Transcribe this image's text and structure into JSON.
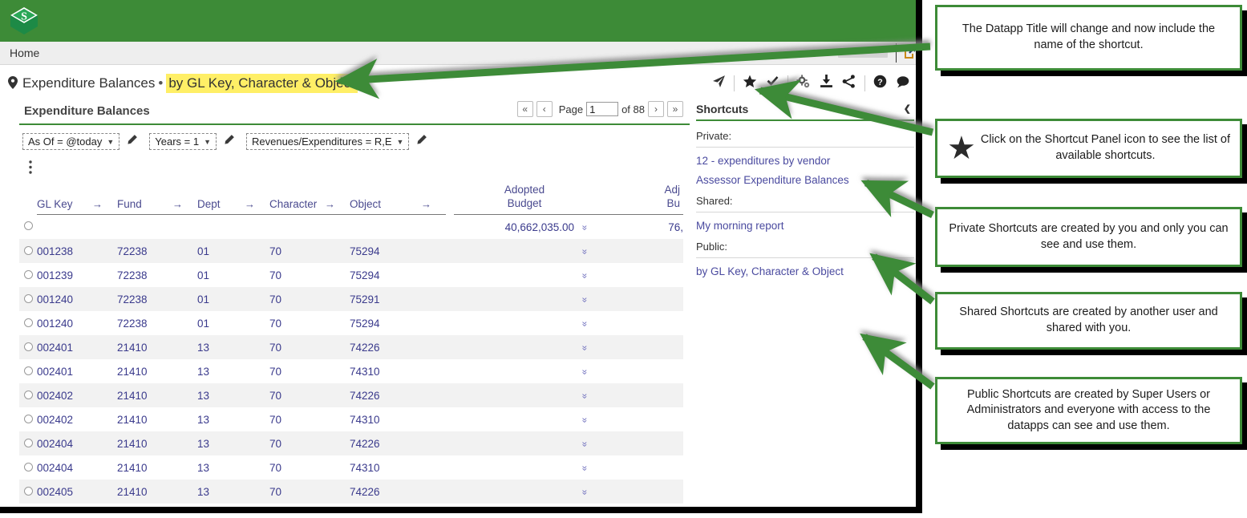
{
  "app": {
    "logo_icon": "dollar-cube-logo",
    "brand_color": "#3d8b37"
  },
  "tabs": {
    "home_label": "Home"
  },
  "page_title": {
    "pin_icon": "location-pin-icon",
    "base": "Expenditure Balances",
    "separator": "•",
    "shortcut_name": "by GL Key, Character & Object",
    "highlight_color": "#ffef66"
  },
  "content": {
    "heading": "Expenditure Balances",
    "pager": {
      "first_label": "«",
      "prev_label": "‹",
      "page_label": "Page",
      "page_value": "1",
      "of_label": "of 88",
      "next_label": "›",
      "last_label": "»"
    },
    "filters": [
      {
        "label": "As Of = @today",
        "caret": "▼",
        "edit_icon": "pencil-icon"
      },
      {
        "label": "Years = 1",
        "caret": "▼",
        "edit_icon": "pencil-icon"
      },
      {
        "label": "Revenues/Expenditures = R,E",
        "caret": "▼",
        "edit_icon": "pencil-icon"
      }
    ],
    "more_menu_icon": "vertical-kebab-icon"
  },
  "table": {
    "columns": [
      {
        "label": "GL Key",
        "sort_icon": "right-arrow-icon",
        "align": "left"
      },
      {
        "label": "Fund",
        "sort_icon": "right-arrow-icon",
        "align": "left"
      },
      {
        "label": "Dept",
        "sort_icon": "right-arrow-icon",
        "align": "left"
      },
      {
        "label": "Character",
        "sort_icon": "right-arrow-icon",
        "align": "left"
      },
      {
        "label": "Object",
        "sort_icon": "right-arrow-icon",
        "align": "left"
      },
      {
        "label_line1": "Adopted",
        "label_line2": "Budget",
        "align": "right"
      },
      {
        "label_line1": "Adj",
        "label_line2": "Bu",
        "align": "right"
      }
    ],
    "expand_icon": "double-chevron-down-icon",
    "row_select_icon": "radio-circle-icon",
    "rows": [
      {
        "gl_key": "",
        "fund": "",
        "dept": "",
        "character": "",
        "object": "",
        "adopted_budget": "40,662,035.00",
        "adj_budget": "76,"
      },
      {
        "gl_key": "001238",
        "fund": "72238",
        "dept": "01",
        "character": "70",
        "object": "75294",
        "adopted_budget": "",
        "adj_budget": ""
      },
      {
        "gl_key": "001239",
        "fund": "72238",
        "dept": "01",
        "character": "70",
        "object": "75294",
        "adopted_budget": "",
        "adj_budget": ""
      },
      {
        "gl_key": "001240",
        "fund": "72238",
        "dept": "01",
        "character": "70",
        "object": "75291",
        "adopted_budget": "",
        "adj_budget": ""
      },
      {
        "gl_key": "001240",
        "fund": "72238",
        "dept": "01",
        "character": "70",
        "object": "75294",
        "adopted_budget": "",
        "adj_budget": ""
      },
      {
        "gl_key": "002401",
        "fund": "21410",
        "dept": "13",
        "character": "70",
        "object": "74226",
        "adopted_budget": "",
        "adj_budget": ""
      },
      {
        "gl_key": "002401",
        "fund": "21410",
        "dept": "13",
        "character": "70",
        "object": "74310",
        "adopted_budget": "",
        "adj_budget": ""
      },
      {
        "gl_key": "002402",
        "fund": "21410",
        "dept": "13",
        "character": "70",
        "object": "74226",
        "adopted_budget": "",
        "adj_budget": ""
      },
      {
        "gl_key": "002402",
        "fund": "21410",
        "dept": "13",
        "character": "70",
        "object": "74310",
        "adopted_budget": "",
        "adj_budget": ""
      },
      {
        "gl_key": "002404",
        "fund": "21410",
        "dept": "13",
        "character": "70",
        "object": "74226",
        "adopted_budget": "",
        "adj_budget": ""
      },
      {
        "gl_key": "002404",
        "fund": "21410",
        "dept": "13",
        "character": "70",
        "object": "74310",
        "adopted_budget": "",
        "adj_budget": ""
      },
      {
        "gl_key": "002405",
        "fund": "21410",
        "dept": "13",
        "character": "70",
        "object": "74226",
        "adopted_budget": "",
        "adj_budget": ""
      }
    ]
  },
  "shortcuts_panel": {
    "toolbar_icons": [
      "send-arrow-icon",
      "star-icon",
      "checkmark-icon",
      "gears-icon",
      "download-icon",
      "share-icon",
      "help-icon",
      "chat-icon"
    ],
    "title": "Shortcuts",
    "collapse_icon": "chevron-down-icon",
    "groups": [
      {
        "label": "Private:",
        "links": [
          "12 - expenditures by vendor",
          "Assessor Expenditure Balances"
        ]
      },
      {
        "label": "Shared:",
        "links": [
          "My morning report"
        ]
      },
      {
        "label": "Public:",
        "links": [
          "by GL Key, Character & Object"
        ]
      }
    ]
  },
  "callouts": [
    {
      "text": "The Datapp Title will change and now include the name of the shortcut.",
      "icon": null
    },
    {
      "text": "Click on the Shortcut Panel icon to see the list of available shortcuts.",
      "icon": "star-icon"
    },
    {
      "text": "Private Shortcuts are created by you and only you can see and use them.",
      "icon": null
    },
    {
      "text": "Shared Shortcuts are created by another user and shared with you.",
      "icon": null
    },
    {
      "text": "Public Shortcuts are created by Super Users or Administrators and everyone with access to the datapps can see and use them.",
      "icon": null
    }
  ],
  "colors": {
    "accent_green": "#3d8b37",
    "link_blue": "#4a4a9f",
    "highlight_yellow": "#ffef66"
  }
}
